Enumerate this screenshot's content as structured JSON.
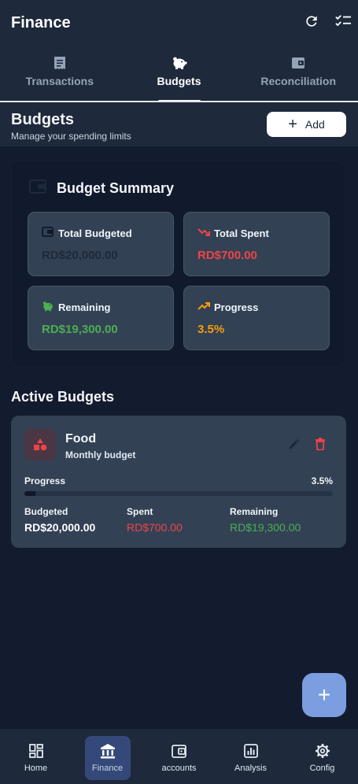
{
  "app": {
    "title": "Finance"
  },
  "tabs": [
    {
      "label": "Transactions",
      "icon": "receipt-icon",
      "active": false
    },
    {
      "label": "Budgets",
      "icon": "piggy-bank-icon",
      "active": true
    },
    {
      "label": "Reconciliation",
      "icon": "wallet-icon",
      "active": false
    }
  ],
  "page": {
    "title": "Budgets",
    "subtitle": "Manage your spending limits",
    "add_label": "Add"
  },
  "summary": {
    "title": "Budget Summary",
    "stats": [
      {
        "label": "Total Budgeted",
        "value": "RD$20,000.00",
        "color": "#1e293b"
      },
      {
        "label": "Total Spent",
        "value": "RD$700.00",
        "color": "#ef4444"
      },
      {
        "label": "Remaining",
        "value": "RD$19,300.00",
        "color": "#4caf50"
      },
      {
        "label": "Progress",
        "value": "3.5%",
        "color": "#f59e0b"
      }
    ]
  },
  "active_budgets": {
    "title": "Active Budgets",
    "items": [
      {
        "name": "Food",
        "period": "Monthly budget",
        "progress_label": "Progress",
        "progress_text": "3.5%",
        "progress_fraction": 0.035,
        "budgeted_label": "Budgeted",
        "budgeted": "RD$20,000.00",
        "spent_label": "Spent",
        "spent": "RD$700.00",
        "remaining_label": "Remaining",
        "remaining": "RD$19,300.00"
      }
    ]
  },
  "fab": {
    "icon": "plus-icon",
    "label": "+"
  },
  "nav": [
    {
      "label": "Home",
      "icon": "dashboard-icon",
      "active": false
    },
    {
      "label": "Finance",
      "icon": "bank-icon",
      "active": true
    },
    {
      "label": "accounts",
      "icon": "wallet-icon",
      "active": false
    },
    {
      "label": "Analysis",
      "icon": "chart-icon",
      "active": false
    },
    {
      "label": "Config",
      "icon": "gear-icon",
      "active": false
    }
  ],
  "colors": {
    "background": "#131b2e",
    "surface": "#1e293b",
    "card": "#334155",
    "accent": "#7b9ee0",
    "danger": "#ef4444",
    "success": "#4caf50",
    "warning": "#f59e0b"
  }
}
